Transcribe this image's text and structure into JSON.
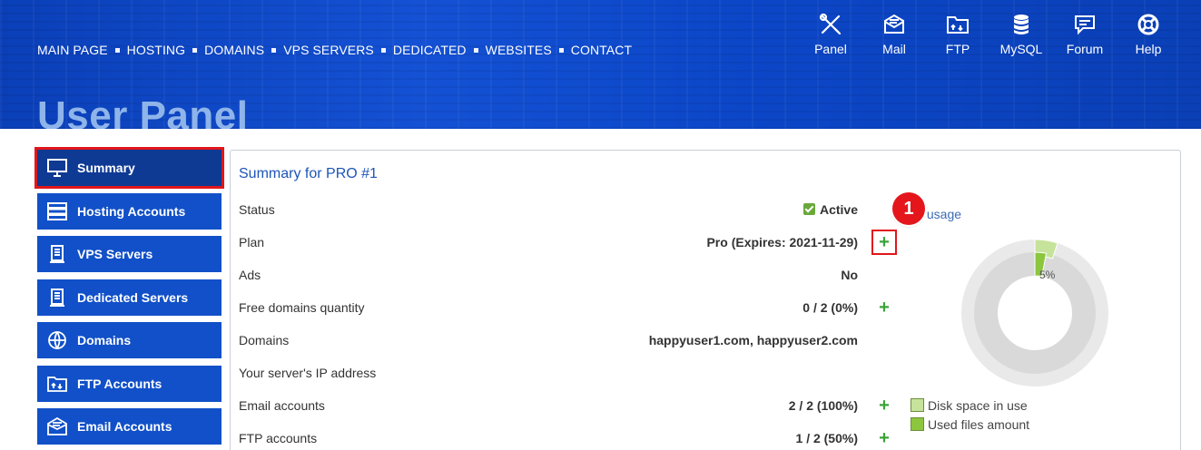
{
  "nav": {
    "items": [
      "MAIN PAGE",
      "HOSTING",
      "DOMAINS",
      "VPS SERVERS",
      "DEDICATED",
      "WEBSITES",
      "CONTACT"
    ]
  },
  "tools": [
    {
      "label": "Panel",
      "icon": "tools-icon"
    },
    {
      "label": "Mail",
      "icon": "mail-icon"
    },
    {
      "label": "FTP",
      "icon": "ftp-folder-icon"
    },
    {
      "label": "MySQL",
      "icon": "database-icon"
    },
    {
      "label": "Forum",
      "icon": "forum-icon"
    },
    {
      "label": "Help",
      "icon": "lifebuoy-icon"
    }
  ],
  "page_title": "User Panel",
  "sidebar": {
    "items": [
      {
        "label": "Summary",
        "icon": "monitor-icon",
        "active": true
      },
      {
        "label": "Hosting Accounts",
        "icon": "server-stack-icon"
      },
      {
        "label": "VPS Servers",
        "icon": "server-tower-icon"
      },
      {
        "label": "Dedicated Servers",
        "icon": "server-tower-icon"
      },
      {
        "label": "Domains",
        "icon": "globe-www-icon"
      },
      {
        "label": "FTP Accounts",
        "icon": "ftp-folder-icon"
      },
      {
        "label": "Email Accounts",
        "icon": "mail-icon"
      }
    ]
  },
  "summary": {
    "title": "Summary for PRO #1",
    "rows": [
      {
        "label": "Status",
        "value": "Active"
      },
      {
        "label": "Plan",
        "value": "Pro (Expires: 2021-11-29)"
      },
      {
        "label": "Ads",
        "value": "No"
      },
      {
        "label": "Free domains quantity",
        "value": "0 / 2 (0%)"
      },
      {
        "label": "Domains",
        "value": "happyuser1.com, happyuser2.com"
      },
      {
        "label": "Your server's IP address",
        "value": ""
      },
      {
        "label": "Email accounts",
        "value": "2 / 2 (100%)"
      },
      {
        "label": "FTP accounts",
        "value": "1 / 2 (50%)"
      }
    ],
    "plus_symbol": "+"
  },
  "callout": {
    "number": "1"
  },
  "usage": {
    "link_text": "k usage",
    "percent_label": "5%",
    "disk_percent": 5,
    "legend": [
      {
        "label": "Disk space in use",
        "color": "#c6e39b"
      },
      {
        "label": "Used files amount",
        "color": "#8cc63e"
      }
    ]
  },
  "colors": {
    "brand": "#1150c8",
    "highlight": "#e0161b",
    "plus": "#3aa33a"
  }
}
